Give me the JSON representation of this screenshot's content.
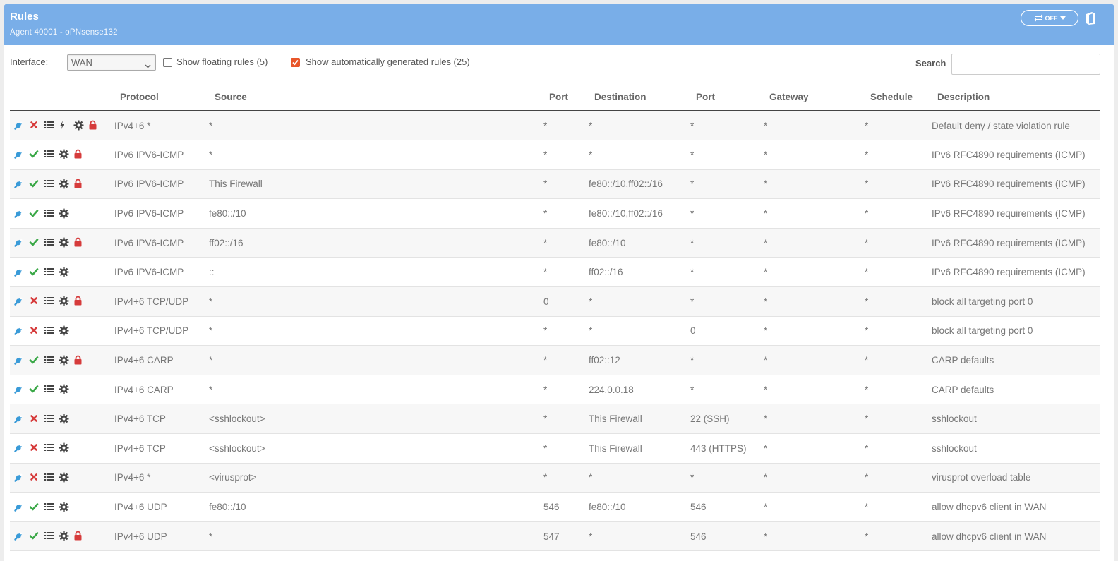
{
  "header": {
    "title": "Rules",
    "subtitle": "Agent 40001 - oPNsense132",
    "toggle_label": "OFF"
  },
  "toolbar": {
    "interface_label": "Interface:",
    "interface_value": "WAN",
    "floating_label": "Show floating rules (5)",
    "floating_checked": false,
    "auto_label": "Show automatically generated rules (25)",
    "auto_checked": true,
    "search_label": "Search",
    "search_value": ""
  },
  "colors": {
    "header": "#79aee8",
    "accent": "#e8562a",
    "pass": "#3aa847",
    "block": "#d63b3b",
    "edit": "#3a9bd8"
  },
  "table": {
    "columns": [
      "Protocol",
      "Source",
      "Port",
      "Destination",
      "Port",
      "Gateway",
      "Schedule",
      "Description"
    ],
    "rows": [
      {
        "action": "block",
        "icons": [
          "edit-icon",
          "status",
          "list-icon",
          "bolt-icon",
          "gear-icon",
          "lock-icon"
        ],
        "protocol": "IPv4+6 *",
        "source": "*",
        "sport": "*",
        "destination": "*",
        "dport": "*",
        "gateway": "*",
        "schedule": "*",
        "description": "Default deny / state violation rule"
      },
      {
        "action": "pass",
        "icons": [
          "edit-icon",
          "status",
          "list-icon",
          "gear-icon",
          "lock-icon"
        ],
        "protocol": "IPv6 IPV6-ICMP",
        "source": "*",
        "sport": "*",
        "destination": "*",
        "dport": "*",
        "gateway": "*",
        "schedule": "*",
        "description": "IPv6 RFC4890 requirements (ICMP)"
      },
      {
        "action": "pass",
        "icons": [
          "edit-icon",
          "status",
          "list-icon",
          "gear-icon",
          "lock-icon"
        ],
        "protocol": "IPv6 IPV6-ICMP",
        "source": "This Firewall",
        "sport": "*",
        "destination": "fe80::/10,ff02::/16",
        "dport": "*",
        "gateway": "*",
        "schedule": "*",
        "description": "IPv6 RFC4890 requirements (ICMP)"
      },
      {
        "action": "pass",
        "icons": [
          "edit-icon",
          "status",
          "list-icon",
          "gear-icon"
        ],
        "protocol": "IPv6 IPV6-ICMP",
        "source": "fe80::/10",
        "sport": "*",
        "destination": "fe80::/10,ff02::/16",
        "dport": "*",
        "gateway": "*",
        "schedule": "*",
        "description": "IPv6 RFC4890 requirements (ICMP)"
      },
      {
        "action": "pass",
        "icons": [
          "edit-icon",
          "status",
          "list-icon",
          "gear-icon",
          "lock-icon"
        ],
        "protocol": "IPv6 IPV6-ICMP",
        "source": "ff02::/16",
        "sport": "*",
        "destination": "fe80::/10",
        "dport": "*",
        "gateway": "*",
        "schedule": "*",
        "description": "IPv6 RFC4890 requirements (ICMP)"
      },
      {
        "action": "pass",
        "icons": [
          "edit-icon",
          "status",
          "list-icon",
          "gear-icon"
        ],
        "protocol": "IPv6 IPV6-ICMP",
        "source": "::",
        "sport": "*",
        "destination": "ff02::/16",
        "dport": "*",
        "gateway": "*",
        "schedule": "*",
        "description": "IPv6 RFC4890 requirements (ICMP)"
      },
      {
        "action": "block",
        "icons": [
          "edit-icon",
          "status",
          "list-icon",
          "gear-icon",
          "lock-icon"
        ],
        "protocol": "IPv4+6 TCP/UDP",
        "source": "*",
        "sport": "0",
        "destination": "*",
        "dport": "*",
        "gateway": "*",
        "schedule": "*",
        "description": "block all targeting port 0"
      },
      {
        "action": "block",
        "icons": [
          "edit-icon",
          "status",
          "list-icon",
          "gear-icon"
        ],
        "protocol": "IPv4+6 TCP/UDP",
        "source": "*",
        "sport": "*",
        "destination": "*",
        "dport": "0",
        "gateway": "*",
        "schedule": "*",
        "description": "block all targeting port 0"
      },
      {
        "action": "pass",
        "icons": [
          "edit-icon",
          "status",
          "list-icon",
          "gear-icon",
          "lock-icon"
        ],
        "protocol": "IPv4+6 CARP",
        "source": "*",
        "sport": "*",
        "destination": "ff02::12",
        "dport": "*",
        "gateway": "*",
        "schedule": "*",
        "description": "CARP defaults"
      },
      {
        "action": "pass",
        "icons": [
          "edit-icon",
          "status",
          "list-icon",
          "gear-icon"
        ],
        "protocol": "IPv4+6 CARP",
        "source": "*",
        "sport": "*",
        "destination": "224.0.0.18",
        "dport": "*",
        "gateway": "*",
        "schedule": "*",
        "description": "CARP defaults"
      },
      {
        "action": "block",
        "icons": [
          "edit-icon",
          "status",
          "list-icon",
          "gear-icon"
        ],
        "protocol": "IPv4+6 TCP",
        "source": "<sshlockout>",
        "sport": "*",
        "destination": "This Firewall",
        "dport": "22 (SSH)",
        "gateway": "*",
        "schedule": "*",
        "description": "sshlockout"
      },
      {
        "action": "block",
        "icons": [
          "edit-icon",
          "status",
          "list-icon",
          "gear-icon"
        ],
        "protocol": "IPv4+6 TCP",
        "source": "<sshlockout>",
        "sport": "*",
        "destination": "This Firewall",
        "dport": "443 (HTTPS)",
        "gateway": "*",
        "schedule": "*",
        "description": "sshlockout"
      },
      {
        "action": "block",
        "icons": [
          "edit-icon",
          "status",
          "list-icon",
          "gear-icon"
        ],
        "protocol": "IPv4+6 *",
        "source": "<virusprot>",
        "sport": "*",
        "destination": "*",
        "dport": "*",
        "gateway": "*",
        "schedule": "*",
        "description": "virusprot overload table"
      },
      {
        "action": "pass",
        "icons": [
          "edit-icon",
          "status",
          "list-icon",
          "gear-icon"
        ],
        "protocol": "IPv4+6 UDP",
        "source": "fe80::/10",
        "sport": "546",
        "destination": "fe80::/10",
        "dport": "546",
        "gateway": "*",
        "schedule": "*",
        "description": "allow dhcpv6 client in WAN"
      },
      {
        "action": "pass",
        "icons": [
          "edit-icon",
          "status",
          "list-icon",
          "gear-icon",
          "lock-icon"
        ],
        "protocol": "IPv4+6 UDP",
        "source": "*",
        "sport": "547",
        "destination": "*",
        "dport": "546",
        "gateway": "*",
        "schedule": "*",
        "description": "allow dhcpv6 client in WAN"
      }
    ]
  }
}
